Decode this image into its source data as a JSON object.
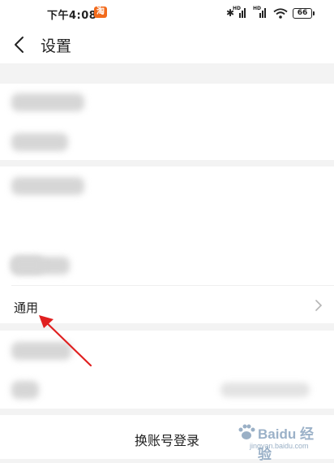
{
  "status_bar": {
    "time": "下午4:08",
    "app_icon_text": "淘",
    "battery": "66",
    "network_tag": "HD"
  },
  "header": {
    "title": "设置"
  },
  "settings": {
    "general_label": "通用"
  },
  "footer": {
    "switch_account_label": "换账号登录"
  },
  "watermark": {
    "brand": "Baidu 经验",
    "url": "jingyan.baidu.com"
  },
  "colors": {
    "background": "#f3f3f3",
    "card": "#ffffff",
    "annotation_arrow": "#e02020",
    "taobao_orange": "#f26a1b"
  }
}
